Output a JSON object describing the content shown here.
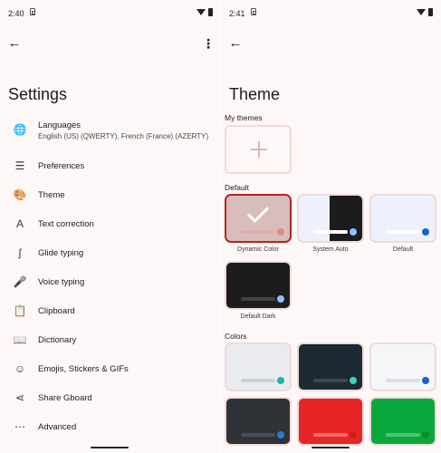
{
  "left": {
    "status": {
      "time": "2:40"
    },
    "title": "Settings",
    "items": [
      {
        "icon": "globe-icon",
        "glyph": "🌐",
        "label": "Languages",
        "sub": "English (US) (QWERTY), French (France) (AZERTY)"
      },
      {
        "icon": "sliders-icon",
        "glyph": "☰",
        "label": "Preferences"
      },
      {
        "icon": "palette-icon",
        "glyph": "🎨",
        "label": "Theme"
      },
      {
        "icon": "text-correction-icon",
        "glyph": "A",
        "label": "Text correction"
      },
      {
        "icon": "glide-typing-icon",
        "glyph": "ʃ",
        "label": "Glide typing"
      },
      {
        "icon": "microphone-icon",
        "glyph": "🎤",
        "label": "Voice typing"
      },
      {
        "icon": "clipboard-icon",
        "glyph": "📋",
        "label": "Clipboard"
      },
      {
        "icon": "dictionary-icon",
        "glyph": "📖",
        "label": "Dictionary"
      },
      {
        "icon": "emoji-icon",
        "glyph": "☺",
        "label": "Emojis, Stickers & GIFs"
      },
      {
        "icon": "share-icon",
        "glyph": "⋖",
        "label": "Share Gboard"
      },
      {
        "icon": "more-icon",
        "glyph": "⋯",
        "label": "Advanced"
      }
    ]
  },
  "right": {
    "status": {
      "time": "2:41"
    },
    "title": "Theme",
    "sections": {
      "my_themes": "My themes",
      "default": "Default",
      "colors": "Colors"
    },
    "default_themes": [
      {
        "name": "Dynamic Color",
        "bg": "#d9bdbd",
        "bar": "#e2aaaa",
        "dot": "#e08888",
        "selected": true
      },
      {
        "name": "System Auto",
        "bg": "#eef1fb",
        "bar": "#ffffff",
        "dot": "#8bc1ff",
        "split": true
      },
      {
        "name": "Default",
        "bg": "#eef1fb",
        "bar": "#ffffff",
        "dot": "#1a62c9"
      },
      {
        "name": "Default Dark",
        "bg": "#1c1c1c",
        "bar": "#444444",
        "dot": "#8bc1ff"
      }
    ],
    "color_themes": [
      {
        "bg": "#e9ebef",
        "bar": "#cdd0d5",
        "dot": "#1ab5a5"
      },
      {
        "bg": "#1b2a33",
        "bar": "#3b4a52",
        "dot": "#3ad2b8"
      },
      {
        "bg": "#f4f6f8",
        "bar": "#dcdfe3",
        "dot": "#1a62c9"
      },
      {
        "bg": "#2f3237",
        "bar": "#4b4f55",
        "dot": "#2b7bd6"
      },
      {
        "bg": "#e62626",
        "bar": "#ef6a6a",
        "dot": "#d11b1b"
      },
      {
        "bg": "#0aa83c",
        "bar": "#4dc474",
        "dot": "#0a8a2f"
      }
    ]
  }
}
